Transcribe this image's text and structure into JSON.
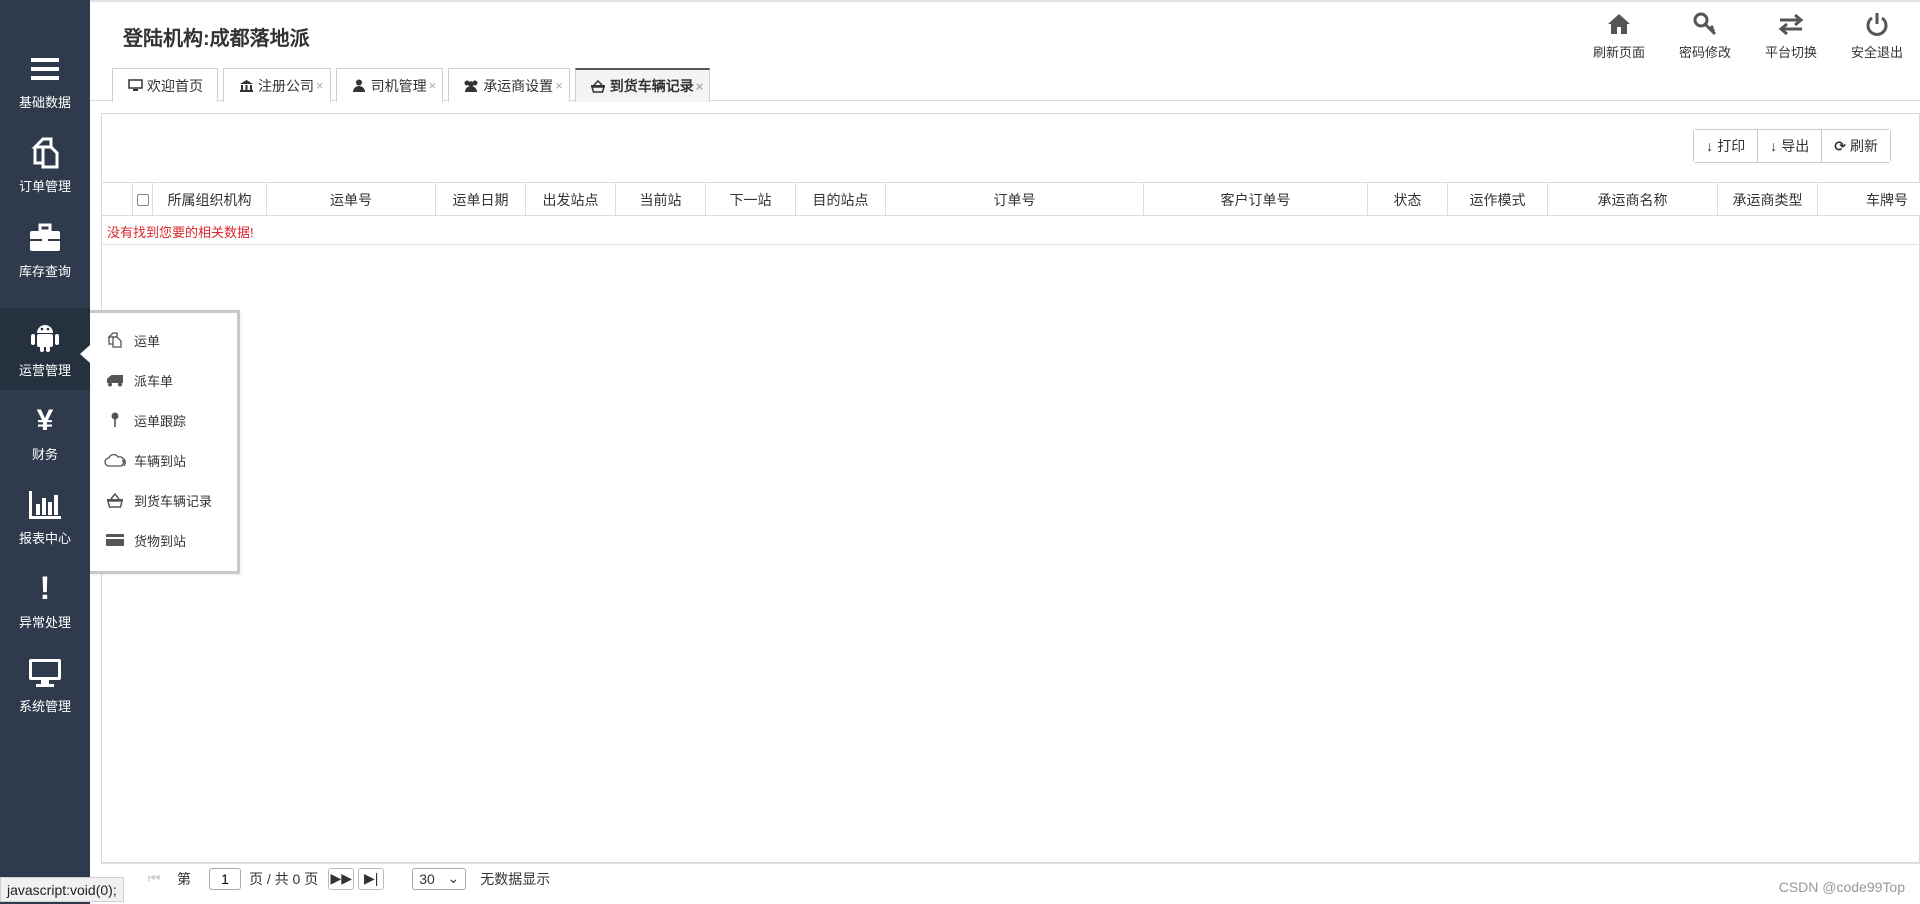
{
  "sidebar": {
    "items": [
      {
        "label": "基础数据",
        "icon": "menu-lines-icon"
      },
      {
        "label": "订单管理",
        "icon": "copy-documents-icon"
      },
      {
        "label": "库存查询",
        "icon": "briefcase-icon"
      },
      {
        "label": "运营管理",
        "icon": "android-icon"
      },
      {
        "label": "财务",
        "icon": "yen-icon"
      },
      {
        "label": "报表中心",
        "icon": "bar-chart-icon"
      },
      {
        "label": "异常处理",
        "icon": "exclamation-icon"
      },
      {
        "label": "系统管理",
        "icon": "monitor-icon"
      }
    ]
  },
  "header": {
    "org_title": "登陆机构:成都落地派",
    "actions": [
      {
        "label": "刷新页面",
        "icon": "home-icon"
      },
      {
        "label": "密码修改",
        "icon": "key-icon"
      },
      {
        "label": "平台切换",
        "icon": "swap-arrows-icon"
      },
      {
        "label": "安全退出",
        "icon": "power-icon"
      }
    ]
  },
  "tabs": [
    {
      "label": "欢迎首页",
      "icon": "desktop-icon",
      "closable": false
    },
    {
      "label": "注册公司",
      "icon": "bank-icon",
      "closable": true
    },
    {
      "label": "司机管理",
      "icon": "user-icon",
      "closable": true
    },
    {
      "label": "承运商设置",
      "icon": "users-icon",
      "closable": true
    },
    {
      "label": "到货车辆记录",
      "icon": "basket-icon",
      "closable": true,
      "active": true
    }
  ],
  "toolbar": {
    "print_label": "打印",
    "export_label": "导出",
    "refresh_label": "刷新"
  },
  "grid": {
    "columns": [
      "所属组织机构",
      "运单号",
      "运单日期",
      "出发站点",
      "当前站",
      "下一站",
      "目的站点",
      "订单号",
      "客户订单号",
      "状态",
      "运作模式",
      "承运商名称",
      "承运商类型",
      "车牌号"
    ],
    "empty_message": "没有找到您要的相关数据!"
  },
  "pager": {
    "page_prefix": "第",
    "page_value": "1",
    "page_suffix": "页 / 共 0 页",
    "page_size": "30",
    "info": "无数据显示"
  },
  "flyout": {
    "items": [
      {
        "label": "运单",
        "icon": "copy-documents-icon"
      },
      {
        "label": "派车单",
        "icon": "truck-icon"
      },
      {
        "label": "运单跟踪",
        "icon": "map-pin-icon"
      },
      {
        "label": "车辆到站",
        "icon": "cloud-icon"
      },
      {
        "label": "到货车辆记录",
        "icon": "basket-icon"
      },
      {
        "label": "货物到站",
        "icon": "credit-card-icon"
      }
    ]
  },
  "status_bar": "javascript:void(0);",
  "watermark": "CSDN @code99Top",
  "colors": {
    "sidebar_bg": "#2f3b4c",
    "error_text": "#d9262c"
  }
}
